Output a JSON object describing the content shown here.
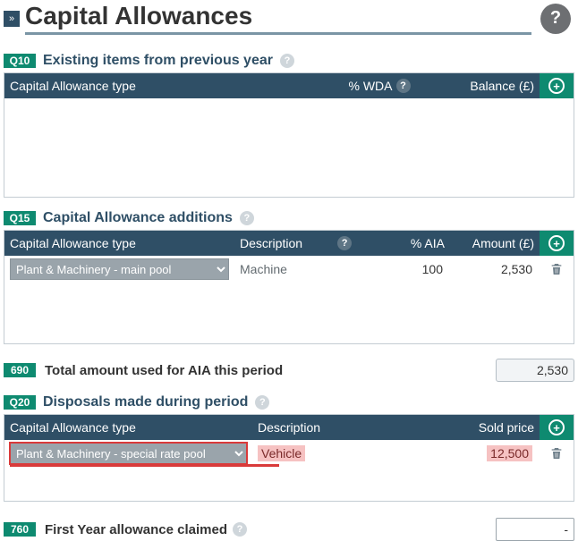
{
  "page": {
    "title": "Capital Allowances"
  },
  "q10": {
    "num": "Q10",
    "title": "Existing items from previous year",
    "col_type": "Capital Allowance type",
    "col_wda": "% WDA",
    "col_balance": "Balance (£)"
  },
  "q15": {
    "num": "Q15",
    "title": "Capital Allowance additions",
    "col_type": "Capital Allowance type",
    "col_desc": "Description",
    "col_aia": "% AIA",
    "col_amount": "Amount (£)",
    "row0": {
      "type": "Plant & Machinery - main pool",
      "desc": "Machine",
      "aia": "100",
      "amount": "2,530"
    }
  },
  "r690": {
    "num": "690",
    "label": "Total amount used for AIA this period",
    "value": "2,530"
  },
  "q20": {
    "num": "Q20",
    "title": "Disposals made during period",
    "col_type": "Capital Allowance type",
    "col_desc": "Description",
    "col_sold": "Sold price",
    "row0": {
      "type": "Plant & Machinery - special rate pool",
      "desc": "Vehicle",
      "sold": "12,500"
    }
  },
  "r760": {
    "num": "760",
    "label": "First Year allowance claimed",
    "value": "-"
  }
}
